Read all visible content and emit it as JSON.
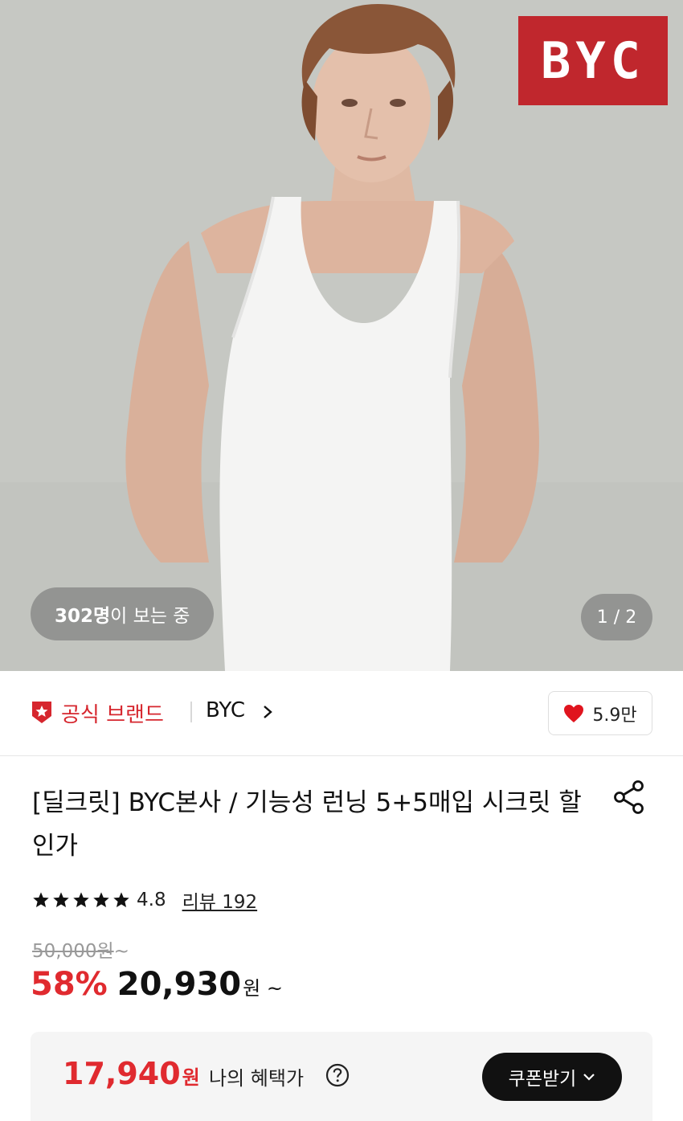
{
  "hero": {
    "logo_text": "BYC",
    "logo_color": "#c0272d",
    "viewers_count": "302명",
    "viewers_suffix": "이 보는 중",
    "pager": "1 / 2"
  },
  "brand": {
    "official_label": "공식 브랜드",
    "name": "BYC",
    "like_count": "5.9만",
    "accent": "#d6262e"
  },
  "product": {
    "title": "[딜크릿] BYC본사 / 기능성 런닝 5+5매입 시크릿 할인가",
    "rating": "4.8",
    "stars": 5,
    "review_label": "리뷰 192",
    "original_price": "50,000원",
    "original_price_suffix": "~",
    "discount": "58%",
    "sale_price": "20,930",
    "sale_unit": "원 ~"
  },
  "benefit": {
    "price": "17,940",
    "unit": "원",
    "label": "나의 혜택가",
    "coupon_button": "쿠폰받기"
  },
  "icons": {
    "badge": "star-badge-icon",
    "like": "heart-icon",
    "share": "share-icon",
    "help": "question-icon",
    "chevron": "chevron-right-icon",
    "dropdown": "chevron-down-icon"
  }
}
